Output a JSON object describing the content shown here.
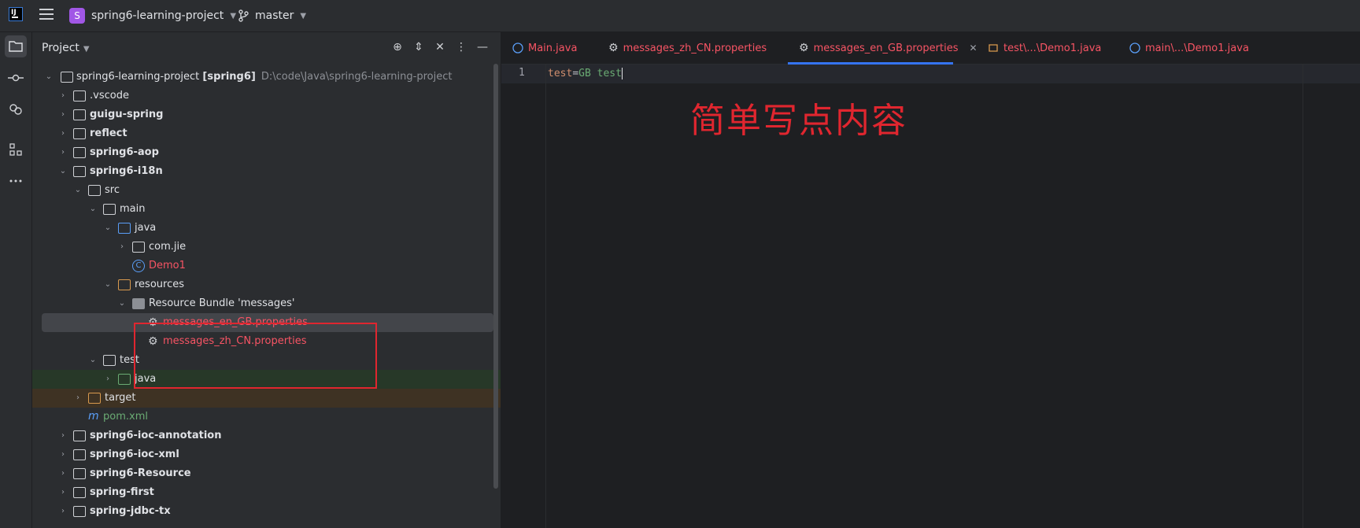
{
  "titlebar": {
    "project_badge": "S",
    "project_name": "spring6-learning-project",
    "branch": "master"
  },
  "panel": {
    "title": "Project"
  },
  "tree": [
    {
      "label": "spring6-learning-project",
      "suffix": "[spring6]",
      "path": "D:\\code\\Java\\spring6-learning-project"
    },
    {
      "label": ".vscode"
    },
    {
      "label": "guigu-spring"
    },
    {
      "label": "reflect"
    },
    {
      "label": "spring6-aop"
    },
    {
      "label": "spring6-i18n"
    },
    {
      "label": "src"
    },
    {
      "label": "main"
    },
    {
      "label": "java"
    },
    {
      "label": "com.jie"
    },
    {
      "label": "Demo1"
    },
    {
      "label": "resources"
    },
    {
      "label": "Resource Bundle 'messages'"
    },
    {
      "label": "messages_en_GB.properties"
    },
    {
      "label": "messages_zh_CN.properties"
    },
    {
      "label": "test"
    },
    {
      "label": "java"
    },
    {
      "label": "target"
    },
    {
      "label": "pom.xml"
    },
    {
      "label": "spring6-ioc-annotation"
    },
    {
      "label": "spring6-ioc-xml"
    },
    {
      "label": "spring6-Resource"
    },
    {
      "label": "spring-first"
    },
    {
      "label": "spring-jdbc-tx"
    }
  ],
  "tabs": [
    {
      "label": "Main.java"
    },
    {
      "label": "messages_zh_CN.properties"
    },
    {
      "label": "messages_en_GB.properties"
    },
    {
      "label": "test\\...\\Demo1.java"
    },
    {
      "label": "main\\...\\Demo1.java"
    }
  ],
  "editor": {
    "line_number": "1",
    "key": "test",
    "eq": "=",
    "value": "GB test",
    "annotation": "简单写点内容"
  },
  "colors": {
    "accent": "#3574f0",
    "annotation_red": "#e0262f",
    "modified_red": "#f75464",
    "green": "#6aab73"
  }
}
